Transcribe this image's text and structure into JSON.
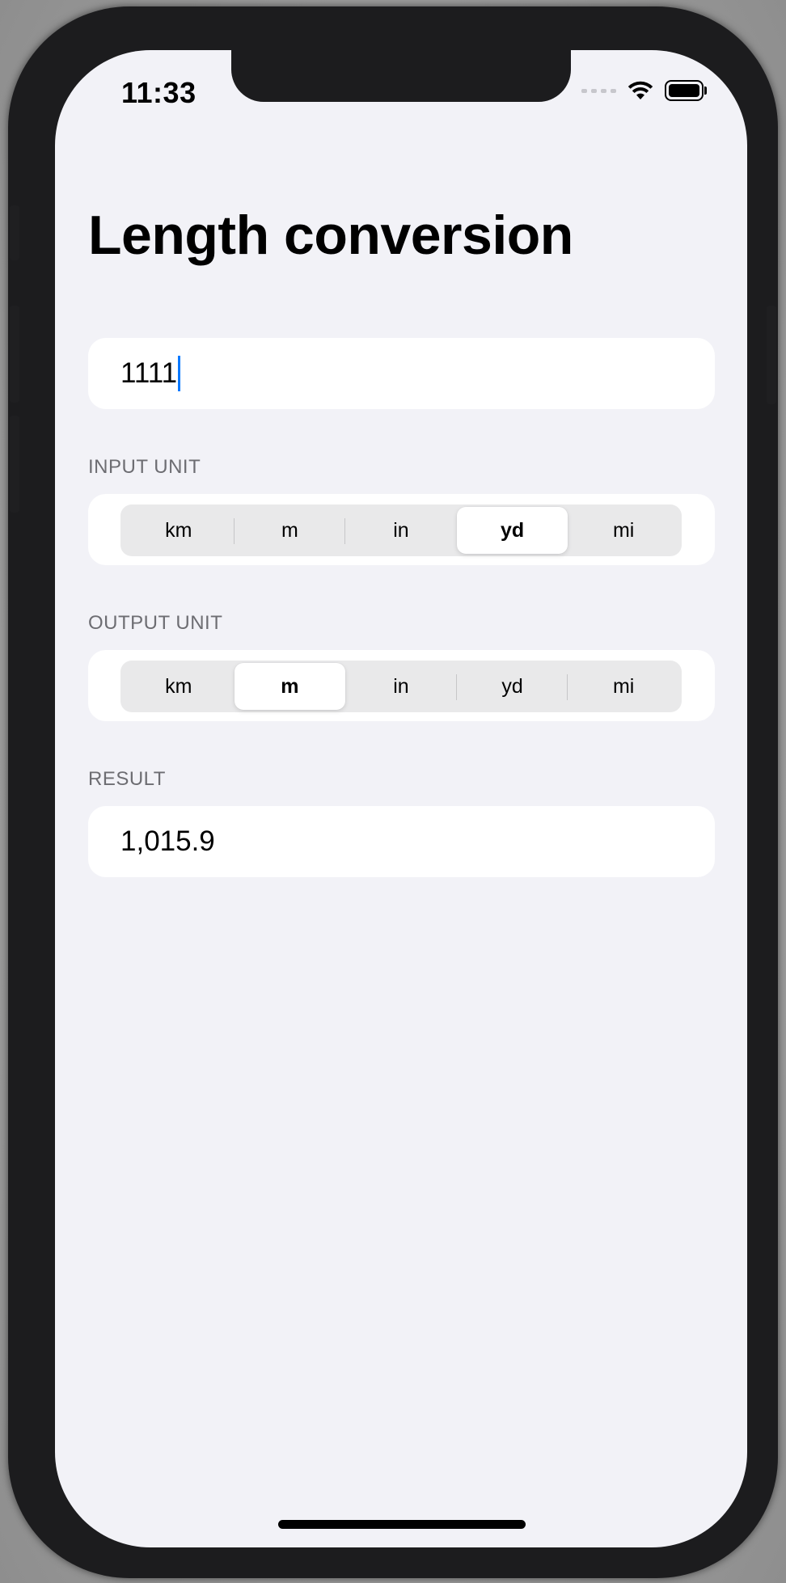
{
  "status_bar": {
    "time": "11:33",
    "icons": [
      "signal-icon",
      "wifi-icon",
      "battery-icon"
    ]
  },
  "title": "Length conversion",
  "input": {
    "value": "1111"
  },
  "input_unit": {
    "label": "INPUT UNIT",
    "options": [
      "km",
      "m",
      "in",
      "yd",
      "mi"
    ],
    "selected": "yd"
  },
  "output_unit": {
    "label": "OUTPUT UNIT",
    "options": [
      "km",
      "m",
      "in",
      "yd",
      "mi"
    ],
    "selected": "m"
  },
  "result": {
    "label": "RESULT",
    "value": "1,015.9"
  },
  "colors": {
    "background": "#f2f2f7",
    "card": "#ffffff",
    "segment_track": "#e9e9ea",
    "caret": "#0a7aff",
    "section_label": "#6d6d72"
  }
}
